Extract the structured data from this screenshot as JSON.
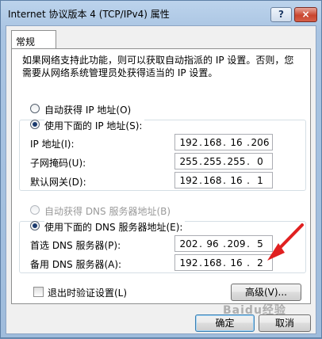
{
  "window": {
    "title": "Internet 协议版本 4 (TCP/IPv4) 属性",
    "help_glyph": "?",
    "close_glyph": "×"
  },
  "tab": {
    "label": "常规"
  },
  "description": "如果网络支持此功能，则可以获取自动指派的 IP 设置。否则，您需要从网络系统管理员处获得适当的 IP 设置。",
  "ip_mode": {
    "auto_label": "自动获得 IP 地址(O)",
    "manual_label": "使用下面的 IP 地址(S):",
    "selected": "manual"
  },
  "ip_fields": [
    {
      "label": "IP 地址(I):",
      "value": [
        "192",
        "168",
        "16",
        "206"
      ]
    },
    {
      "label": "子网掩码(U):",
      "value": [
        "255",
        "255",
        "255",
        "0"
      ]
    },
    {
      "label": "默认网关(D):",
      "value": [
        "192",
        "168",
        "16",
        "1"
      ]
    }
  ],
  "dns_mode": {
    "auto_label": "自动获得 DNS 服务器地址(B)",
    "manual_label": "使用下面的 DNS 服务器地址(E):",
    "selected": "manual",
    "auto_disabled": true
  },
  "dns_fields": [
    {
      "label": "首选 DNS 服务器(P):",
      "value": [
        "202",
        "96",
        "209",
        "5"
      ]
    },
    {
      "label": "备用 DNS 服务器(A):",
      "value": [
        "192",
        "168",
        "16",
        "2"
      ]
    }
  ],
  "validate_on_exit": {
    "label": "退出时验证设置(L)",
    "checked": false
  },
  "buttons": {
    "advanced": "高级(V)...",
    "ok": "确定",
    "cancel": "取消"
  },
  "watermark": "Baidu经验",
  "colors": {
    "annotation_arrow": "#e02020",
    "default_button_border": "#3c7fb1"
  }
}
